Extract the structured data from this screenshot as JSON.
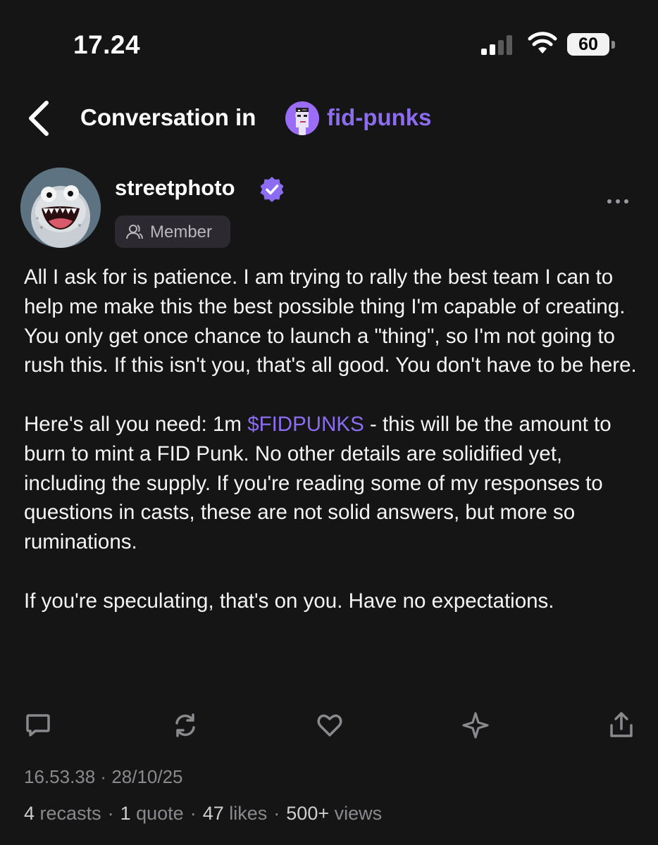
{
  "status_bar": {
    "time": "17.24",
    "battery": "60"
  },
  "header": {
    "title": "Conversation in",
    "channel": "fid-punks"
  },
  "post": {
    "author": "streetphoto",
    "role_badge": "Member",
    "paragraphs": [
      "All I ask for is patience. I am trying to rally the best team I can to help me make this the best possible thing I'm capable of creating. You only get once chance to launch a \"thing\", so I'm not going to rush this. If this isn't you, that's all good. You don't have to be here.",
      "",
      "If you're speculating, that's on you. Have no expectations."
    ],
    "para2_before": "Here's all you need:  1m ",
    "para2_cashtag": "$FIDPUNKS",
    "para2_after": " - this will be the amount to burn to mint a FID Punk. No other details are solidified yet, including the supply. If you're reading some of my responses to questions in casts, these are not solid answers, but more so ruminations.",
    "timestamp": "16.53.38 · 28/10/25",
    "stats": {
      "recasts_count": "4",
      "recasts_label": "recasts",
      "quotes_count": "1",
      "quotes_label": "quote",
      "likes_count": "47",
      "likes_label": "likes",
      "views_count": "500+",
      "views_label": "views"
    }
  },
  "icons": {
    "back": "chevron-left-icon",
    "verified": "verified-badge-icon",
    "member": "person-icon",
    "more": "ellipsis-icon",
    "reply": "comment-icon",
    "recast": "recast-icon",
    "like": "heart-icon",
    "boost": "sparkle-icon",
    "share": "share-icon"
  },
  "colors": {
    "background": "#151515",
    "accent": "#8c6cf0",
    "muted": "#8a8a8e"
  }
}
